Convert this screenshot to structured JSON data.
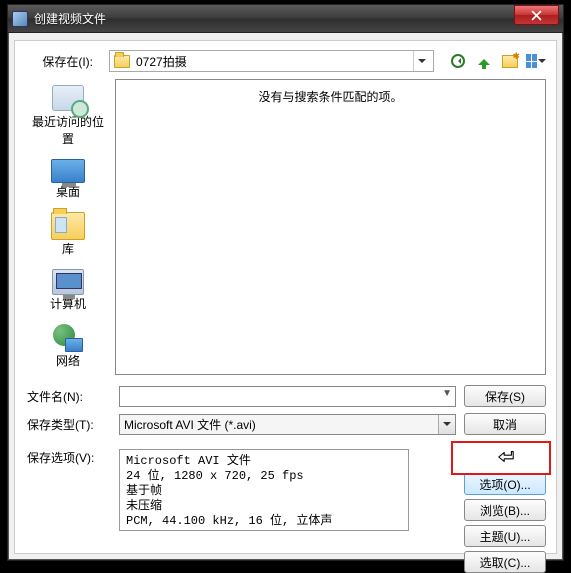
{
  "title": "创建视频文件",
  "savein_label": "保存在(I):",
  "folder_name": "0727拍摄",
  "empty_msg": "没有与搜索条件匹配的项。",
  "sidebar": {
    "items": [
      {
        "label": "最近访问的位置"
      },
      {
        "label": "桌面"
      },
      {
        "label": "库"
      },
      {
        "label": "计算机"
      },
      {
        "label": "网络"
      }
    ]
  },
  "filename_label": "文件名(N):",
  "filename_value": "",
  "filetype_label": "保存类型(T):",
  "filetype_value": "Microsoft AVI 文件 (*.avi)",
  "save_label": "保存(S)",
  "cancel_label": "取消",
  "saveopt_label": "保存选项(V):",
  "opt_text": "Microsoft AVI 文件\n24 位, 1280 x 720, 25 fps\n基于帧\n未压缩\nPCM, 44.100 kHz, 16 位, 立体声",
  "options_label": "选项(O)...",
  "browse_label": "浏览(B)...",
  "theme_label": "主题(U)...",
  "select_label": "选取(C)..."
}
